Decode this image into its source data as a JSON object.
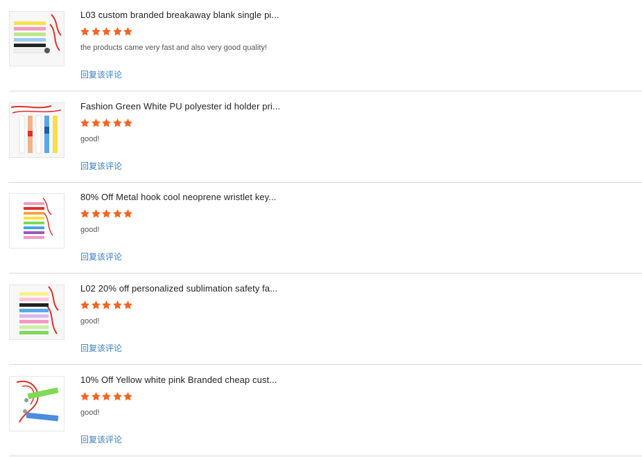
{
  "reviews": [
    {
      "title": "L03 custom branded breakaway blank single pi...",
      "rating": 5,
      "comment": "the products came very fast and also very good quality!",
      "reply_label": "回复该评论",
      "thumbnail_icon": "lanyard-product-thumbnail"
    },
    {
      "title": "Fashion Green White PU polyester id holder pri...",
      "rating": 5,
      "comment": "good!",
      "reply_label": "回复该评论",
      "thumbnail_icon": "lanyard-product-thumbnail"
    },
    {
      "title": "80% Off Metal hook cool neoprene wristlet key...",
      "rating": 5,
      "comment": "good!",
      "reply_label": "回复该评论",
      "thumbnail_icon": "lanyard-product-thumbnail"
    },
    {
      "title": "L02 20% off personalized sublimation safety fa...",
      "rating": 5,
      "comment": "good!",
      "reply_label": "回复该评论",
      "thumbnail_icon": "lanyard-product-thumbnail"
    },
    {
      "title": "10% Off Yellow white pink Branded cheap cust...",
      "rating": 5,
      "comment": "good!",
      "reply_label": "回复该评论",
      "thumbnail_icon": "lanyard-product-thumbnail"
    }
  ],
  "colors": {
    "star": "#f26522",
    "link": "#3a7fc1",
    "divider": "#d8d8d8"
  }
}
